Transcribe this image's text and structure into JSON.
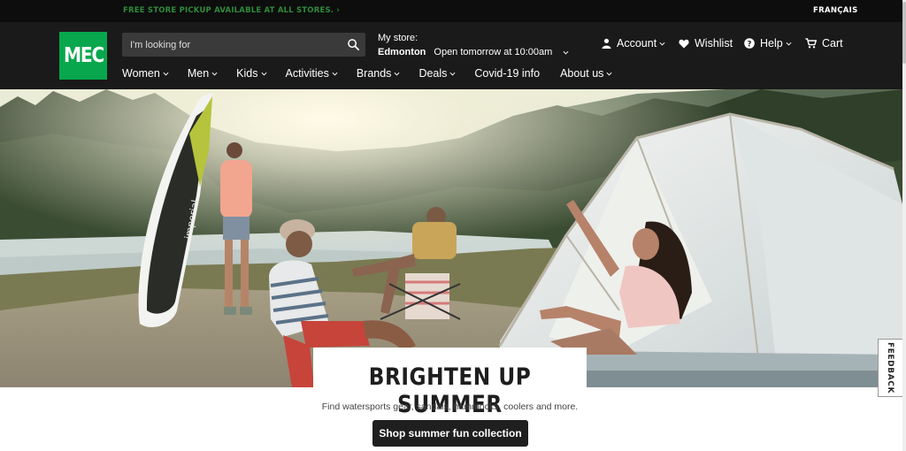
{
  "promo": {
    "text": "FREE STORE PICKUP AVAILABLE AT ALL STORES. ›",
    "language_link": "FRANÇAIS"
  },
  "header": {
    "logo": "MEC",
    "search": {
      "placeholder": "I'm looking for",
      "value": ""
    },
    "store": {
      "label": "My store:",
      "name": "Edmonton",
      "hours": "Open tomorrow at 10:00am"
    },
    "utility": {
      "account": "Account",
      "wishlist": "Wishlist",
      "help": "Help",
      "cart": "Cart"
    },
    "nav": [
      {
        "label": "Women",
        "has_menu": true
      },
      {
        "label": "Men",
        "has_menu": true
      },
      {
        "label": "Kids",
        "has_menu": true
      },
      {
        "label": "Activities",
        "has_menu": true
      },
      {
        "label": "Brands",
        "has_menu": true
      },
      {
        "label": "Deals",
        "has_menu": true
      },
      {
        "label": "Covid-19 info",
        "has_menu": false
      },
      {
        "label": "About us",
        "has_menu": true
      }
    ]
  },
  "hero": {
    "title": "BRIGHTEN UP SUMMER",
    "subtitle": "Find watersports gear, sandals, hammocks, coolers and more.",
    "cta": "Shop summer fun collection",
    "board_text": "imperial"
  },
  "feedback": "FEEDBACK",
  "colors": {
    "brand_green": "#08a74d",
    "header_bg": "#1a1a1a",
    "promo_green": "#2e8b3a"
  }
}
